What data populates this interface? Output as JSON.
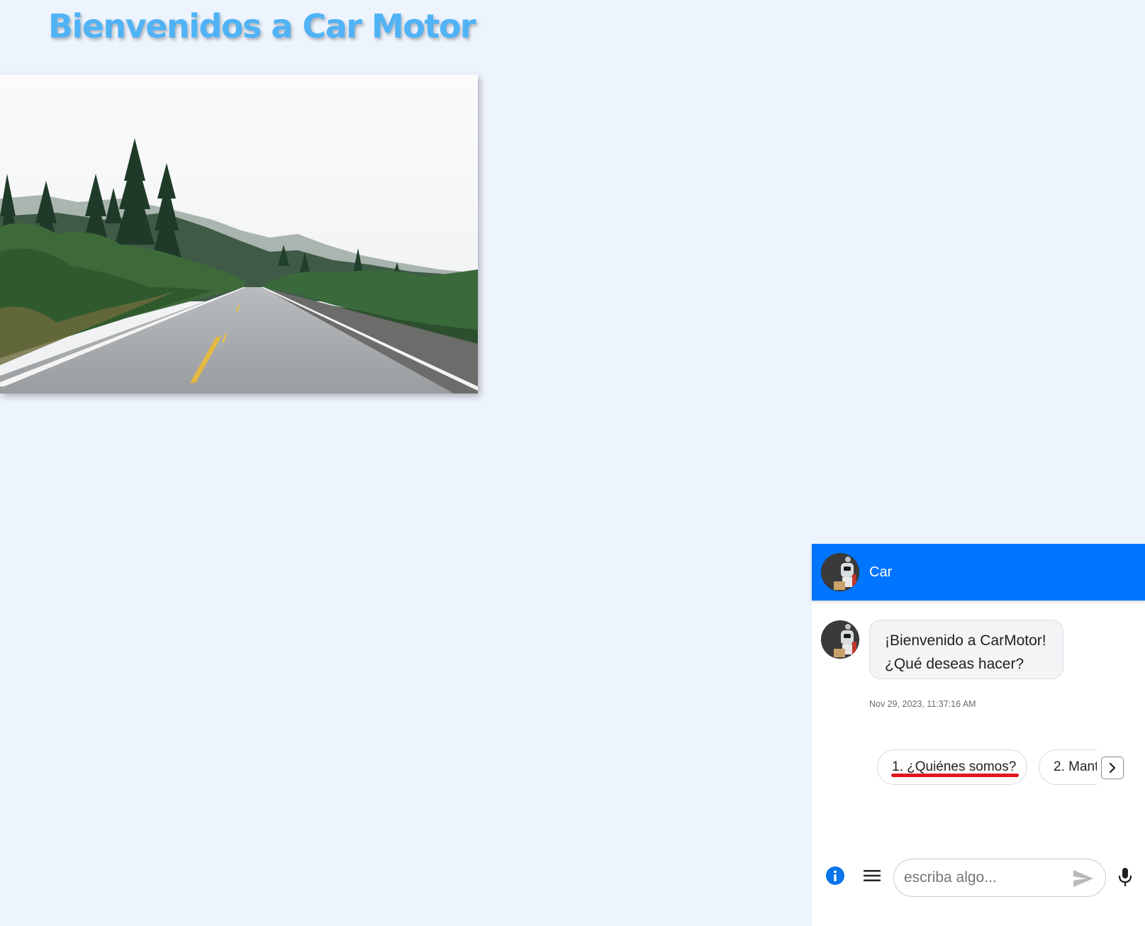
{
  "page": {
    "title": "Bienvenidos a Car Motor",
    "title_color": "#4fb3f6",
    "background_color": "#eef4fe",
    "hero_image": "road-through-forest-photo"
  },
  "chat": {
    "header": {
      "bot_name": "Car",
      "color": "#0075ff",
      "avatar": "robot-avatar"
    },
    "messages": [
      {
        "sender": "bot",
        "lines": [
          "¡Bienvenido a CarMotor!",
          "¿Qué deseas hacer?"
        ],
        "timestamp": "Nov 29, 2023, 11:37:16 AM"
      }
    ],
    "quick_replies": [
      "1. ¿Quiénes somos?",
      "2. Mant"
    ],
    "quick_reply_next_icon": "chevron-right-icon",
    "input": {
      "placeholder": "escriba algo...",
      "value": ""
    },
    "icons": {
      "info": "info-icon",
      "menu": "menu-icon",
      "send": "send-icon",
      "mic": "microphone-icon"
    }
  }
}
